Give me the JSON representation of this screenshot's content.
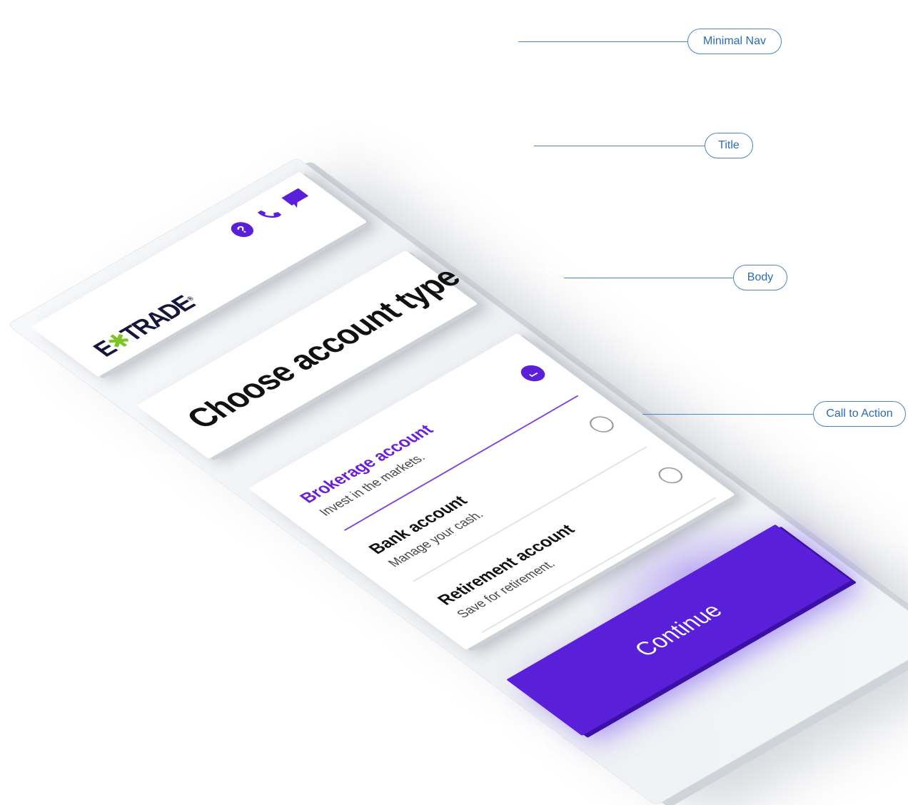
{
  "nav": {
    "logo_text_left": "E",
    "logo_star": "✱",
    "logo_text_right": "TRADE",
    "logo_registered": "®",
    "icons": [
      "help-icon",
      "phone-icon",
      "chat-icon"
    ]
  },
  "title": {
    "text": "Choose account type"
  },
  "body": {
    "options": [
      {
        "label": "Brokerage account",
        "description": "Invest in the markets.",
        "selected": true
      },
      {
        "label": "Bank account",
        "description": "Manage your cash.",
        "selected": false
      },
      {
        "label": "Retirement account",
        "description": "Save for retirement.",
        "selected": false
      }
    ]
  },
  "cta": {
    "label": "Continue"
  },
  "callouts": {
    "nav": "Minimal Nav",
    "title": "Title",
    "body": "Body",
    "cta": "Call to Action"
  },
  "colors": {
    "primary": "#5a1fd8",
    "selected_text": "#6a1ed8",
    "logo_accent": "#7bc424",
    "callout": "#4a86c8"
  }
}
